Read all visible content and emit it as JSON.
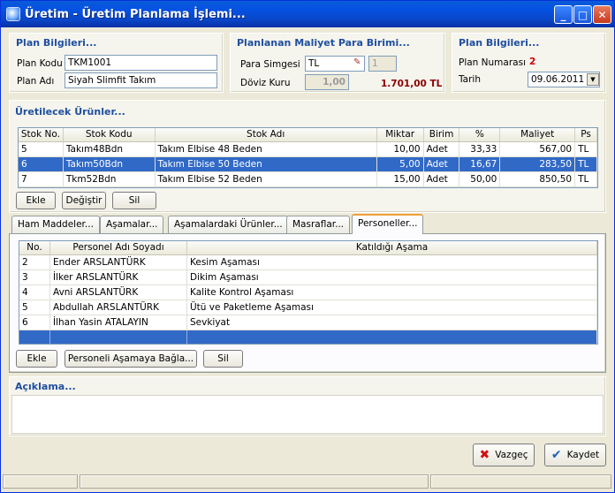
{
  "window": {
    "title": "Üretim - Üretim Planlama İşlemi..."
  },
  "plan_info": {
    "title": "Plan Bilgileri...",
    "code_label": "Plan Kodu",
    "code_value": "TKM1001",
    "name_label": "Plan Adı",
    "name_value": "Siyah Slimfit Takım"
  },
  "cost_currency": {
    "title": "Planlanan Maliyet Para Birimi...",
    "symbol_label": "Para Simgesi",
    "symbol_value": "TL",
    "symbol_qty": "1",
    "rate_label": "Döviz Kuru",
    "rate_value": "1,00",
    "total": "1.701,00 TL"
  },
  "plan_info2": {
    "title": "Plan Bilgileri...",
    "number_label": "Plan Numarası",
    "number_value": "2",
    "date_label": "Tarih",
    "date_value": "09.06.2011"
  },
  "products": {
    "title": "Üretilecek Ürünler...",
    "columns": [
      "Stok No.",
      "Stok Kodu",
      "Stok Adı",
      "Miktar",
      "Birim",
      "%",
      "Maliyet",
      "Ps"
    ],
    "rows": [
      [
        "5",
        "Takım48Bdn",
        "Takım Elbise 48 Beden",
        "10,00",
        "Adet",
        "33,33",
        "567,00",
        "TL"
      ],
      [
        "6",
        "Takım50Bdn",
        "Takım Elbise 50 Beden",
        "5,00",
        "Adet",
        "16,67",
        "283,50",
        "TL"
      ],
      [
        "7",
        "Tkm52Bdn",
        "Takım Elbise 52 Beden",
        "15,00",
        "Adet",
        "50,00",
        "850,50",
        "TL"
      ]
    ],
    "buttons": {
      "add": "Ekle",
      "edit": "Değiştir",
      "delete": "Sil"
    }
  },
  "tabs": [
    "Ham Maddeler...",
    "Aşamalar...",
    "Aşamalardaki Ürünler...",
    "Masraflar...",
    "Personeller..."
  ],
  "personnel": {
    "columns": [
      "No.",
      "Personel Adı Soyadı",
      "Katıldığı Aşama"
    ],
    "rows": [
      [
        "2",
        "Ender ARSLANTÜRK",
        "Kesim Aşaması"
      ],
      [
        "3",
        "İlker ARSLANTÜRK",
        "Dikim Aşaması"
      ],
      [
        "4",
        "Avni ARSLANTÜRK",
        "Kalite Kontrol Aşaması"
      ],
      [
        "5",
        "Abdullah ARSLANTÜRK",
        "Ütü ve Paketleme Aşaması"
      ],
      [
        "6",
        "İlhan Yasin ATALAYIN",
        "Sevkiyat"
      ]
    ],
    "buttons": {
      "add": "Ekle",
      "assign": "Personeli Aşamaya Bağla...",
      "delete": "Sil"
    }
  },
  "description": {
    "title": "Açıklama..."
  },
  "footer": {
    "cancel": "Vazgeç",
    "save": "Kaydet"
  },
  "colors": {
    "accent": "#1f4fa0",
    "selection": "#3169c6",
    "total_red": "#8b0000",
    "plan_number_red": "#cc0000"
  }
}
